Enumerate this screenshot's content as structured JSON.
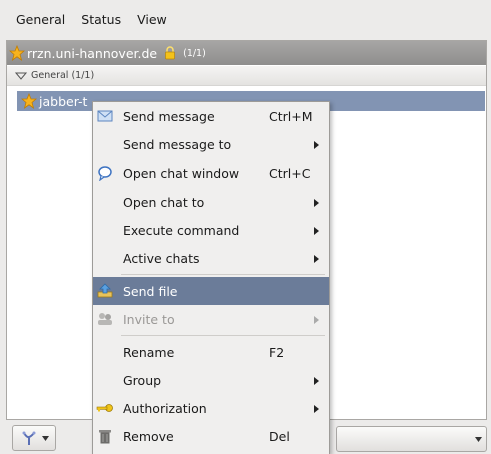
{
  "menubar": {
    "items": [
      "General",
      "Status",
      "View"
    ]
  },
  "roster": {
    "account": {
      "name": "rrzn.uni-hannover.de",
      "count": "(1/1)",
      "icon": "star-icon",
      "lock_icon": "lock-icon"
    },
    "group": {
      "name": "General (1/1)",
      "icon": "triangle-down-icon"
    },
    "contact": {
      "name": "jabber-t"
    }
  },
  "context_menu": {
    "items": [
      {
        "label": "Send message",
        "shortcut": "Ctrl+M",
        "icon": "envelope-icon"
      },
      {
        "label": "Send message to",
        "submenu": true
      },
      {
        "label": "Open chat window",
        "shortcut": "Ctrl+C",
        "icon": "chat-bubble-icon"
      },
      {
        "label": "Open chat to",
        "submenu": true
      },
      {
        "label": "Execute command",
        "submenu": true
      },
      {
        "label": "Active chats",
        "submenu": true
      },
      {
        "label": "Send file",
        "icon": "upload-icon",
        "highlighted": true
      },
      {
        "label": "Invite to",
        "icon": "group-icon",
        "submenu": true,
        "disabled": true
      },
      {
        "label": "Rename",
        "shortcut": "F2"
      },
      {
        "label": "Group",
        "submenu": true
      },
      {
        "label": "Authorization",
        "icon": "key-icon",
        "submenu": true
      },
      {
        "label": "Remove",
        "shortcut": "Del",
        "icon": "trash-icon"
      }
    ]
  },
  "bottombar": {
    "tool_icon": "psi-tool-icon"
  },
  "colors": {
    "highlight": "#6b7c99",
    "selection": "#8294b3",
    "account_bar": "#9a9998"
  }
}
